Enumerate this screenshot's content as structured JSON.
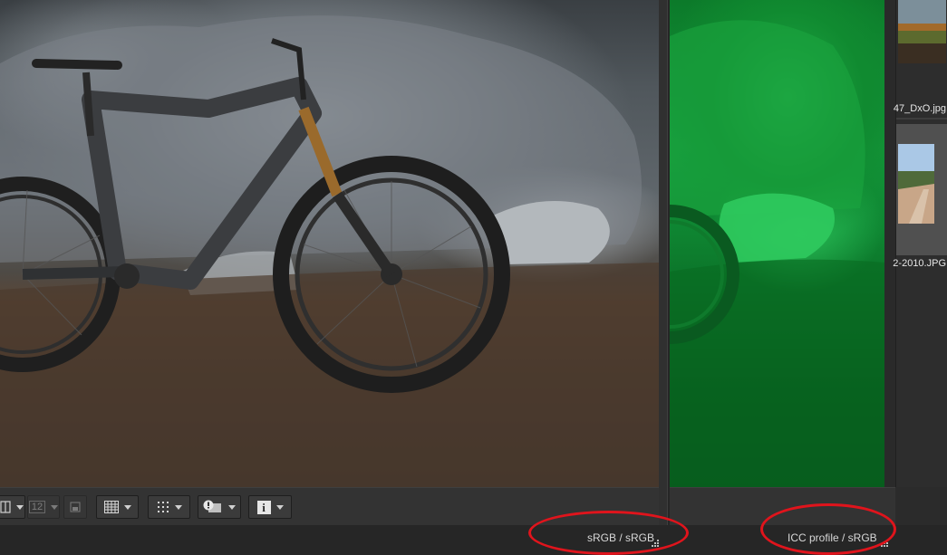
{
  "viewers": {
    "left": {
      "profile_label": "sRGB / sRGB"
    },
    "right": {
      "profile_label": "ICC profile / sRGB"
    }
  },
  "filmstrip": {
    "items": [
      {
        "filename_tail": "47_DxO.jpg"
      },
      {
        "filename_tail": "2-2010.JPG"
      }
    ]
  },
  "toolbar": {
    "buttons": [
      {
        "icon": "compare-view-icon",
        "state": "enabled"
      },
      {
        "icon": "split-view-icon",
        "label": "12",
        "state": "disabled"
      },
      {
        "icon": "grid-overlay-icon",
        "state": "enabled"
      },
      {
        "icon": "dot-grid-icon",
        "state": "enabled"
      },
      {
        "icon": "warning-overlay-icon",
        "state": "enabled"
      },
      {
        "icon": "info-icon",
        "label": "i",
        "state": "enabled"
      }
    ]
  },
  "annotations": {
    "highlight_color": "#e0141c"
  },
  "colors": {
    "proof_overlay": "#13963a",
    "panel_bg": "#333333",
    "status_bg": "#262626"
  }
}
